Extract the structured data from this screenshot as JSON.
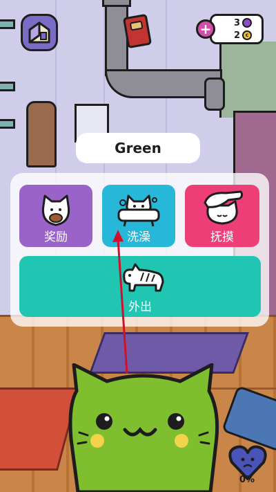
{
  "pet": {
    "name": "Green"
  },
  "currency": {
    "gems": "3",
    "coins": "2",
    "add_label": "+",
    "coin_glyph": "c"
  },
  "actions": {
    "reward_label": "奖励",
    "bath_label": "洗澡",
    "pet_label": "抚摸",
    "go_out_label": "外出"
  },
  "status": {
    "happiness": "0%"
  },
  "colors": {
    "reward": "#9a63c9",
    "bath": "#27b7d9",
    "pet": "#ee3e77",
    "go_out": "#20c6b2",
    "cat": "#7fbe2e",
    "annotation_arrow": "#d0102a"
  },
  "icons": {
    "home": "house-icon",
    "book": "book-icon",
    "add": "plus-icon",
    "gem": "gem-icon",
    "coin": "coin-icon",
    "happiness": "heart-icon"
  }
}
